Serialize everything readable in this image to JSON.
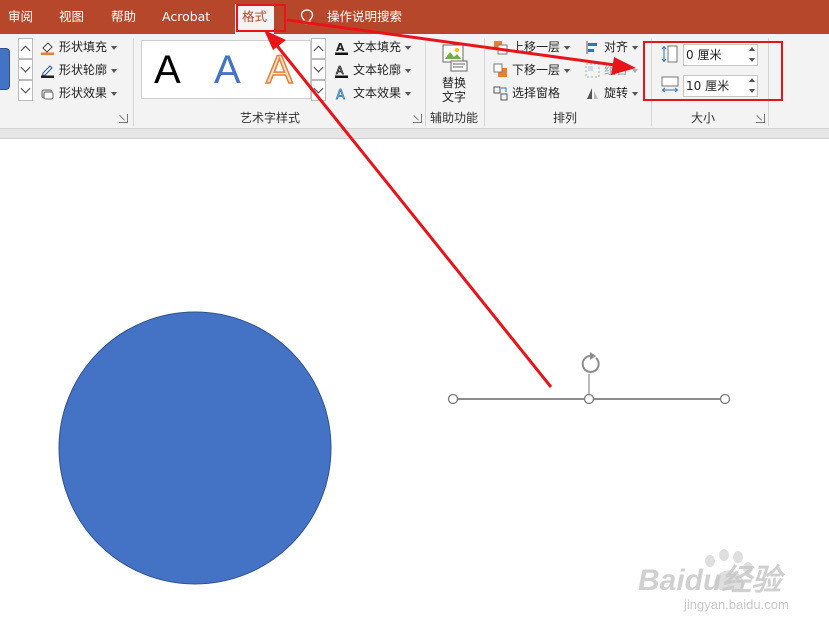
{
  "tabs": [
    {
      "label": "审阅",
      "active": false
    },
    {
      "label": "视图",
      "active": false
    },
    {
      "label": "帮助",
      "active": false
    },
    {
      "label": "Acrobat",
      "active": false
    },
    {
      "label": "格式",
      "active": true
    }
  ],
  "tell_me": {
    "icon": "lightbulb-icon",
    "label": "操作说明搜索"
  },
  "shape_styles": {
    "fill": "形状填充",
    "outline": "形状轮廓",
    "effects": "形状效果"
  },
  "wordart": {
    "gallery": [
      "A",
      "A",
      "A"
    ],
    "text_fill": "文本填充",
    "text_outline": "文本轮廓",
    "text_effects": "文本效果",
    "group_label": "艺术字样式"
  },
  "accessibility": {
    "alt_text_line1": "替换",
    "alt_text_line2": "文字",
    "group_label": "辅助功能"
  },
  "arrange": {
    "bring_forward": "上移一层",
    "send_backward": "下移一层",
    "selection_pane": "选择窗格",
    "align": "对齐",
    "group": "组合",
    "rotate": "旋转",
    "group_label": "排列"
  },
  "size": {
    "height": "0 厘米",
    "width": "10 厘米",
    "group_label": "大小"
  },
  "watermark": {
    "text": "Baidu经验",
    "sub": "jingyan.baidu.com"
  },
  "colors": {
    "tab_bar": "#b7472a",
    "ribbon": "#f3f3f3",
    "circle_fill": "#4472c4",
    "circle_stroke": "#2f528f",
    "annotation": "#e8141a",
    "line_shape": "#8c8c8c"
  }
}
